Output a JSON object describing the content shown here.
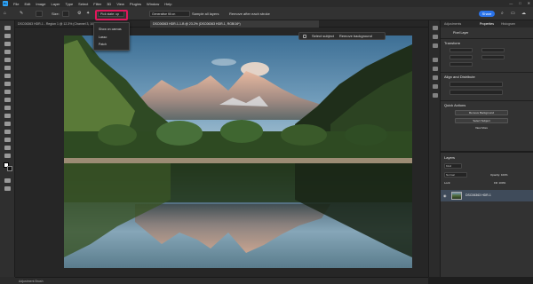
{
  "menu": {
    "logo": "Ps",
    "items": [
      "File",
      "Edit",
      "Image",
      "Layer",
      "Type",
      "Select",
      "Filter",
      "3D",
      "View",
      "Plugins",
      "Window",
      "Help"
    ]
  },
  "window_controls": [
    "—",
    "□",
    "✕"
  ],
  "options_bar": {
    "size_label": "Size:",
    "select_subject_label": "Pick state: op",
    "generative_label": "Generative fill on",
    "sample_all_layers": "Sample all layers",
    "remove_after_label": "Remove after each stroke",
    "share_label": "Share"
  },
  "doc_tabs": [
    {
      "label": "DSC06363 HDR-1 - Region 1 @ 12.3% (Channel 3, 16/8)*"
    },
    {
      "label": "DSC06363 HDR-1-1-B @ 23.2% (DSC06363 HDR-1, RGB/16*)"
    }
  ],
  "context_bar": {
    "select_subject": "Select subject",
    "remove_background": "Remove background"
  },
  "dropdown": {
    "items": [
      "Show on canvas",
      "Lasso",
      "Patch"
    ]
  },
  "right_panel": {
    "tabs": [
      "Adjustments",
      "Properties",
      "Histogram"
    ],
    "active_tab": "Properties",
    "pixel_layer": "Pixel Layer",
    "transform_title": "Transform",
    "align_title": "Align and Distribute",
    "quick_actions_title": "Quick Actions",
    "quick_actions": [
      "Remove Background",
      "Select Subject",
      "View More"
    ]
  },
  "layers_panel": {
    "title": "Layers",
    "kind_label": "Kind",
    "blend_mode": "Normal",
    "opacity_label": "Opacity: 100%",
    "lock_label": "Lock:",
    "fill_label": "Fill: 100%",
    "layer_name": "DSC06363 HDR-1"
  },
  "status": {
    "text": "Adjustment Brush"
  },
  "colors": {
    "accent": "#2a73ea",
    "highlight": "#e0175b"
  }
}
